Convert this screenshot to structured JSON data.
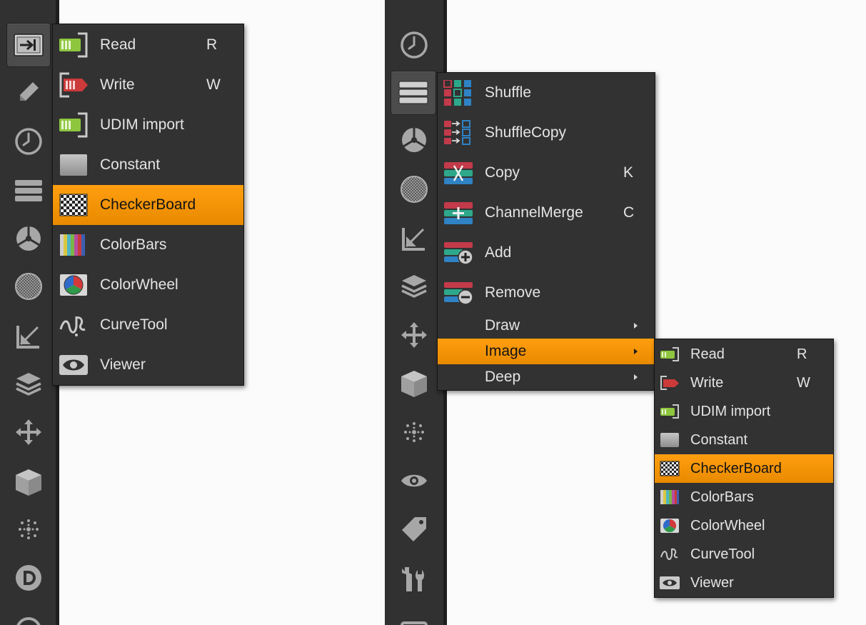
{
  "left_menu": {
    "items": [
      {
        "label": "Read",
        "shortcut": "R",
        "icon": "read-icon"
      },
      {
        "label": "Write",
        "shortcut": "W",
        "icon": "write-icon"
      },
      {
        "label": "UDIM import",
        "shortcut": "",
        "icon": "udim-import-icon"
      },
      {
        "label": "Constant",
        "shortcut": "",
        "icon": "constant-icon"
      },
      {
        "label": "CheckerBoard",
        "shortcut": "",
        "icon": "checkerboard-icon",
        "highlighted": true
      },
      {
        "label": "ColorBars",
        "shortcut": "",
        "icon": "colorbars-icon"
      },
      {
        "label": "ColorWheel",
        "shortcut": "",
        "icon": "colorwheel-icon"
      },
      {
        "label": "CurveTool",
        "shortcut": "",
        "icon": "curvetool-icon"
      },
      {
        "label": "Viewer",
        "shortcut": "",
        "icon": "viewer-icon"
      }
    ]
  },
  "right_menu": {
    "items": [
      {
        "label": "Shuffle",
        "shortcut": "",
        "icon": "shuffle-icon"
      },
      {
        "label": "ShuffleCopy",
        "shortcut": "",
        "icon": "shufflecopy-icon"
      },
      {
        "label": "Copy",
        "shortcut": "K",
        "icon": "copy-icon"
      },
      {
        "label": "ChannelMerge",
        "shortcut": "C",
        "icon": "channelmerge-icon"
      },
      {
        "label": "Add",
        "shortcut": "",
        "icon": "add-channel-icon"
      },
      {
        "label": "Remove",
        "shortcut": "",
        "icon": "remove-channel-icon"
      },
      {
        "label": "Draw",
        "submenu": true
      },
      {
        "label": "Image",
        "submenu": true,
        "highlighted": true
      },
      {
        "label": "Deep",
        "submenu": true
      }
    ]
  },
  "image_submenu": {
    "items": [
      {
        "label": "Read",
        "shortcut": "R",
        "icon": "read-icon"
      },
      {
        "label": "Write",
        "shortcut": "W",
        "icon": "write-icon"
      },
      {
        "label": "UDIM import",
        "shortcut": "",
        "icon": "udim-import-icon"
      },
      {
        "label": "Constant",
        "shortcut": "",
        "icon": "constant-icon"
      },
      {
        "label": "CheckerBoard",
        "shortcut": "",
        "icon": "checkerboard-icon",
        "highlighted": true
      },
      {
        "label": "ColorBars",
        "shortcut": "",
        "icon": "colorbars-icon"
      },
      {
        "label": "ColorWheel",
        "shortcut": "",
        "icon": "colorwheel-icon"
      },
      {
        "label": "CurveTool",
        "shortcut": "",
        "icon": "curvetool-icon"
      },
      {
        "label": "Viewer",
        "shortcut": "",
        "icon": "viewer-icon"
      }
    ]
  },
  "colors": {
    "highlight": "#f29200",
    "menu_bg": "#323232",
    "toolbar_bg": "#313131",
    "menu_text": "#e4e4e4",
    "canvas_bg": "#fbfbfb"
  }
}
